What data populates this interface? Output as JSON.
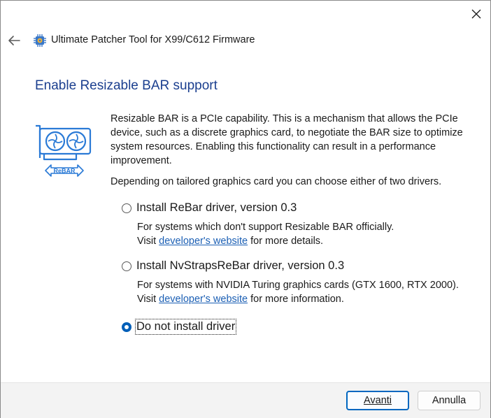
{
  "window": {
    "title": "Ultimate Patcher Tool for X99/C612 Firmware"
  },
  "page": {
    "heading": "Enable Resizable BAR support",
    "description": "Resizable BAR is a PCIe capability. This is a mechanism that allows the PCIe device, such as a discrete graphics card, to negotiate the BAR size to optimize system resources. Enabling this functionality can result in a performance improvement.",
    "instruction": "Depending on tailored graphics card you can choose either of two drivers.",
    "illustration_label": "ReBAR"
  },
  "options": [
    {
      "label": "Install ReBar driver, version 0.3",
      "detail_line1": "For systems which don't support Resizable BAR officially.",
      "visit_prefix": "Visit ",
      "link_text": "developer's website",
      "visit_suffix": " for more details.",
      "selected": false
    },
    {
      "label": "Install NvStrapsReBar driver, version 0.3",
      "detail_line1": "For systems with NVIDIA Turing graphics cards (GTX 1600, RTX 2000).",
      "visit_prefix": "Visit ",
      "link_text": "developer's website",
      "visit_suffix": " for more information.",
      "selected": false
    },
    {
      "label": "Do not install driver",
      "selected": true
    }
  ],
  "buttons": {
    "next_label": "Avanti",
    "cancel_label": "Annulla"
  },
  "colors": {
    "accent": "#005fb8",
    "heading": "#1b3f8f",
    "link": "#1b5fb4",
    "illustration": "#2a7ad6"
  },
  "icons": {
    "close": "close-icon",
    "back": "back-arrow-icon",
    "app": "chip-gear-icon"
  }
}
